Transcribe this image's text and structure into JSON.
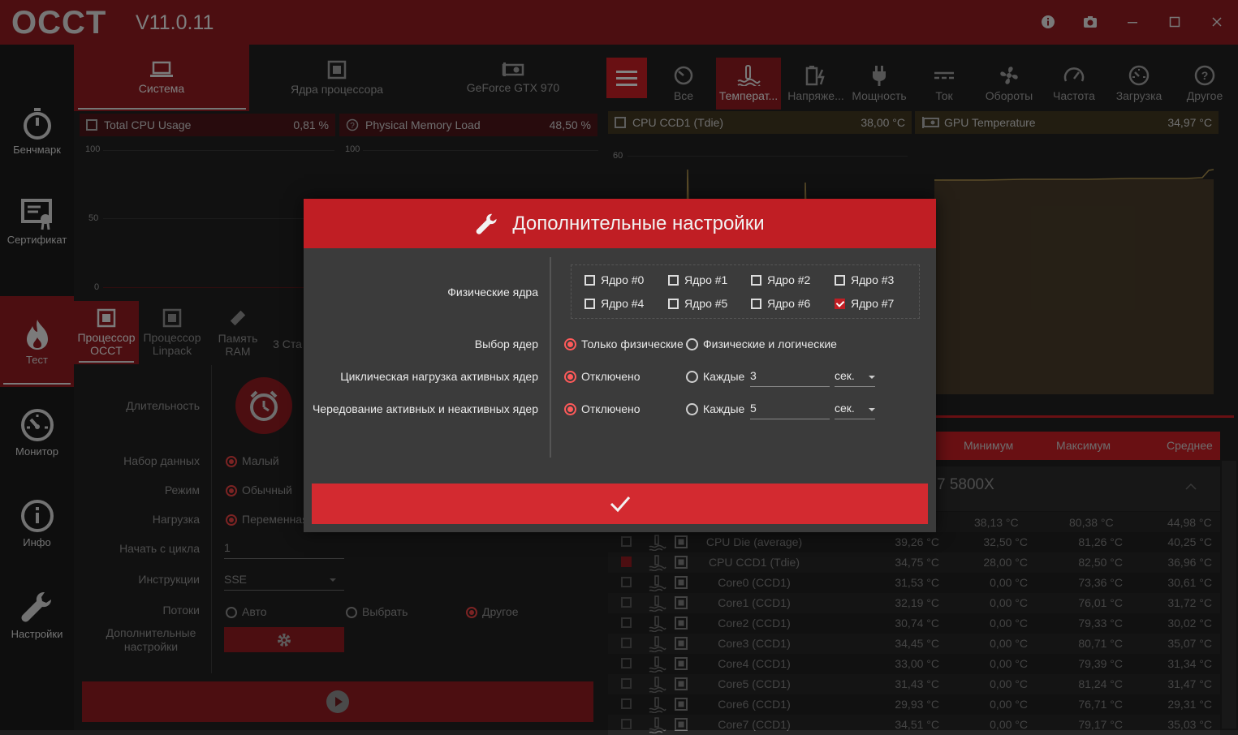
{
  "app": {
    "logo": "OCCT",
    "version": "V11.0.11"
  },
  "titlebar": {
    "buttons": [
      "info-icon",
      "camera-icon",
      "minimize-icon",
      "maximize-icon",
      "close-icon"
    ]
  },
  "sidebar": {
    "items": [
      {
        "label": "Бенчмарк",
        "icon": "stopwatch-icon"
      },
      {
        "label": "Сертификат",
        "icon": "certificate-icon"
      },
      {
        "label": "Тест",
        "icon": "flame-icon",
        "active": true
      },
      {
        "label": "Монитор",
        "icon": "gauge-icon"
      },
      {
        "label": "Инфо",
        "icon": "info-icon"
      },
      {
        "label": "Настройки",
        "icon": "wrench-icon"
      }
    ]
  },
  "left": {
    "tabs": [
      "Система",
      "Ядра процессора",
      "GeForce GTX 970"
    ],
    "graphs": [
      {
        "title": "Total CPU Usage",
        "value": "0,81 %",
        "ticks": [
          "100",
          "50",
          "0"
        ]
      },
      {
        "title": "Physical Memory Load",
        "value": "48,50 %",
        "ticks": [
          "100"
        ]
      }
    ],
    "subtabs": [
      "Процессор OCCT",
      "Процессор Linpack",
      "Память RAM",
      "3 Ста"
    ],
    "form": {
      "duration_label": "Длительность",
      "dataset_label": "Набор данных",
      "dataset_value": "Малый",
      "mode_label": "Режим",
      "mode_value": "Обычный",
      "load_label": "Нагрузка",
      "load_value": "Переменная",
      "start_cycle_label": "Начать с цикла",
      "start_cycle_value": "1",
      "instructions_label": "Инструкции",
      "instructions_value": "SSE",
      "threads_label": "Потоки",
      "threads_auto": "Авто",
      "threads_select": "Выбрать",
      "threads_other": "Другое",
      "advanced_label": "Дополнительные настройки"
    }
  },
  "right": {
    "tabs": [
      "Все",
      "Температ...",
      "Напряже...",
      "Мощность",
      "Ток",
      "Обороты",
      "Частота",
      "Загрузка",
      "Другое"
    ],
    "graphs": [
      {
        "title": "CPU CCD1 (Tdie)",
        "value": "38,00 °C",
        "tick": "60"
      },
      {
        "title": "GPU Temperature",
        "value": "34,97 °C"
      }
    ],
    "table_headers": [
      "Минимум",
      "Максимум",
      "Среднее"
    ],
    "group_title": "7 5800X",
    "group_row": {
      "min": "38,13 °C",
      "max": "80,38 °C",
      "avg": "44,98 °C"
    },
    "rows": [
      {
        "name": "CPU Die (average)",
        "cur": "39,26 °C",
        "min": "32,50 °C",
        "max": "81,26 °C",
        "avg": "40,25 °C",
        "checked": false
      },
      {
        "name": "CPU CCD1 (Tdie)",
        "cur": "34,75 °C",
        "min": "28,00 °C",
        "max": "82,50 °C",
        "avg": "36,96 °C",
        "checked": true
      },
      {
        "name": "Core0 (CCD1)",
        "cur": "31,53 °C",
        "min": "0,00 °C",
        "max": "73,36 °C",
        "avg": "30,61 °C",
        "checked": false
      },
      {
        "name": "Core1 (CCD1)",
        "cur": "32,19 °C",
        "min": "0,00 °C",
        "max": "76,01 °C",
        "avg": "31,72 °C",
        "checked": false
      },
      {
        "name": "Core2 (CCD1)",
        "cur": "30,74 °C",
        "min": "0,00 °C",
        "max": "79,33 °C",
        "avg": "30,02 °C",
        "checked": false
      },
      {
        "name": "Core3 (CCD1)",
        "cur": "34,45 °C",
        "min": "0,00 °C",
        "max": "80,71 °C",
        "avg": "35,07 °C",
        "checked": false
      },
      {
        "name": "Core4 (CCD1)",
        "cur": "33,00 °C",
        "min": "0,00 °C",
        "max": "79,39 °C",
        "avg": "31,34 °C",
        "checked": false
      },
      {
        "name": "Core5 (CCD1)",
        "cur": "31,43 °C",
        "min": "0,00 °C",
        "max": "81,24 °C",
        "avg": "31,47 °C",
        "checked": false
      },
      {
        "name": "Core6 (CCD1)",
        "cur": "29,93 °C",
        "min": "0,00 °C",
        "max": "76,71 °C",
        "avg": "29,31 °C",
        "checked": false
      },
      {
        "name": "Core7 (CCD1)",
        "cur": "34,51 °C",
        "min": "0,00 °C",
        "max": "79,17 °C",
        "avg": "35,03 °C",
        "checked": false
      }
    ]
  },
  "modal": {
    "title": "Дополнительные настройки",
    "physical_cores_label": "Физические ядра",
    "cores": [
      {
        "label": "Ядро #0",
        "checked": false
      },
      {
        "label": "Ядро #1",
        "checked": false
      },
      {
        "label": "Ядро #2",
        "checked": false
      },
      {
        "label": "Ядро #3",
        "checked": false
      },
      {
        "label": "Ядро #4",
        "checked": false
      },
      {
        "label": "Ядро #5",
        "checked": false
      },
      {
        "label": "Ядро #6",
        "checked": false
      },
      {
        "label": "Ядро #7",
        "checked": true
      }
    ],
    "core_select_label": "Выбор ядер",
    "core_select_opt1": "Только физические",
    "core_select_opt2": "Физические и логические",
    "cyclic_label": "Циклическая нагрузка активных ядер",
    "alternate_label": "Чередование активных и неактивных ядер",
    "disabled_label": "Отключено",
    "every_label": "Каждые",
    "cyclic_value": "3",
    "alternate_value": "5",
    "unit": "сек."
  },
  "colors": {
    "accent": "#c01e24",
    "dark_red": "#8b1a1f",
    "radio_on": "#ff5a5a"
  }
}
